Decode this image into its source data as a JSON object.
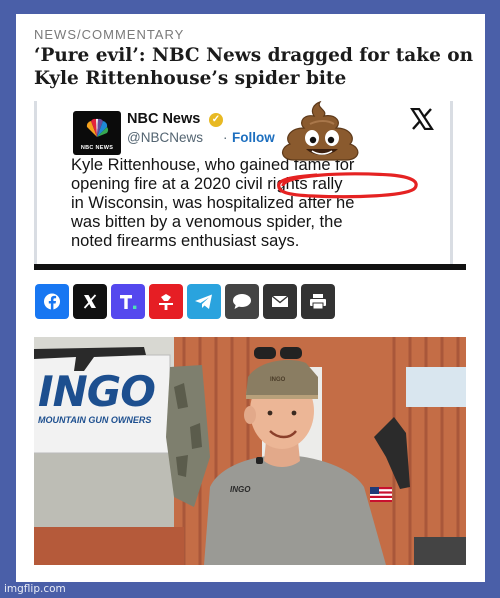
{
  "article": {
    "kicker": "NEWS/COMMENTARY",
    "headline_line1": "‘Pure evil’: NBC News dragged for take on",
    "headline_line2": "Kyle Rittenhouse’s spider bite"
  },
  "tweet": {
    "logo_caption": "NBC NEWS",
    "author_name": "NBC News",
    "handle": "@NBCNews",
    "separator": "·",
    "follow_label": "Follow",
    "text_line1": "Kyle Rittenhouse, who gained fame for",
    "text_line2": "opening fire at a 2020 civil rights rally",
    "text_line3": "in Wisconsin, was hospitalized after he",
    "text_line4": "was bitten by a venomous spider, the",
    "text_line5": "noted firearms enthusiast says.",
    "icons": [
      "nbc-peacock-icon",
      "verified-badge-icon",
      "x-logo-icon",
      "poop-emoji-icon"
    ],
    "annotation_color": "#e52222"
  },
  "share_bar": {
    "buttons": [
      {
        "name": "facebook",
        "color": "#1877f2"
      },
      {
        "name": "x",
        "color": "#111111"
      },
      {
        "name": "truth-social",
        "color": "#5448ee"
      },
      {
        "name": "gettr",
        "color": "#e61e24"
      },
      {
        "name": "telegram",
        "color": "#2aa3de"
      },
      {
        "name": "comment",
        "color": "#444444"
      },
      {
        "name": "email",
        "color": "#333333"
      },
      {
        "name": "print",
        "color": "#333333"
      }
    ]
  },
  "photo": {
    "sign_text": "INGO",
    "sign_subtext": "MOUNTAIN GUN OWNERS",
    "cap_text": "INGO",
    "shirt_text": "INGO"
  },
  "footer": {
    "watermark": "imgflip.com"
  }
}
